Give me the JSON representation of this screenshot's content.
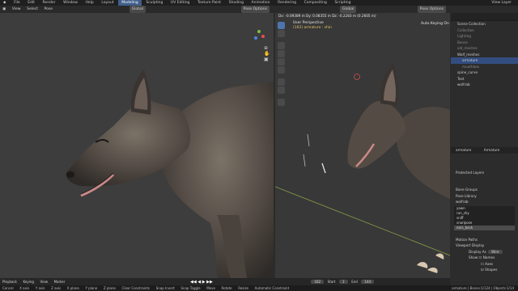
{
  "topbar": {
    "menus": [
      "File",
      "Edit",
      "Render",
      "Window",
      "Help"
    ],
    "workspaces": [
      "Layout",
      "Modeling",
      "Sculpting",
      "UV Editing",
      "Texture Paint",
      "Shading",
      "Animation",
      "Rendering",
      "Compositing",
      "Scripting"
    ],
    "active_workspace": "Modeling",
    "scene_label": "View Layer"
  },
  "left_view": {
    "menus": [
      "View",
      "Select",
      "Pose"
    ],
    "orientation": "Global",
    "pose_options": "Pose Options"
  },
  "right_view": {
    "delta_readout": "Dx: -0.09389 m  Dy: 0.08355 m  Dz: -0.2283 m (0.2605 m)",
    "orientation": "Global",
    "pose_options": "Pose Options",
    "title": "User Perspective",
    "subtitle": "(162) armature : shin",
    "auto_keying": "Auto Keying On"
  },
  "outliner": {
    "items": [
      {
        "label": "Scene Collection",
        "selected": false,
        "dim": false
      },
      {
        "label": "Collection",
        "selected": false,
        "dim": true
      },
      {
        "label": "Lighting",
        "selected": false,
        "dim": true
      },
      {
        "label": "Bones",
        "selected": false,
        "dim": true
      },
      {
        "label": "old_meshes",
        "selected": false,
        "dim": true
      },
      {
        "label": "Wolf_meshes",
        "selected": false,
        "dim": false
      },
      {
        "label": "armature",
        "selected": true,
        "dim": false
      },
      {
        "label": "mouthbox",
        "selected": false,
        "dim": true
      },
      {
        "label": "spine_curve",
        "selected": false,
        "dim": false
      },
      {
        "label": "Text",
        "selected": false,
        "dim": false
      },
      {
        "label": "wolfrab",
        "selected": false,
        "dim": false
      }
    ]
  },
  "properties": {
    "object_name": "armature",
    "data_name": "Armature",
    "section_layers": "Protected Layers",
    "bone_groups": "Bone Groups",
    "pose_library": "Pose Library",
    "library_name": "wolfrab",
    "poses": [
      "yawn",
      "run_shy",
      "sniff",
      "snarlpose",
      "ears_back"
    ],
    "selected_pose": "ears_back",
    "motion_paths": "Motion Paths",
    "viewport_display": "Viewport Display",
    "display_as_label": "Display As",
    "display_as_value": "Wire",
    "show_label": "Show",
    "show_names": "Names",
    "show_axes": "Axes",
    "show_shapes": "Shapes"
  },
  "timeline": {
    "menus": [
      "Playback",
      "Keying",
      "View",
      "Marker"
    ],
    "current_frame": "162",
    "start_label": "Start",
    "start": "1",
    "end_label": "End",
    "end": "144"
  },
  "status": {
    "items": [
      "Cancel",
      "X axis",
      "Y axis",
      "Z axis",
      "X plane",
      "Y plane",
      "Z plane",
      "Clear Constraints",
      "Snap Invert",
      "Snap Toggle",
      "Move",
      "Rotate",
      "Resize",
      "Automatic Constraint",
      "Automatic Constraint Plane"
    ],
    "right_text": "armature | Bones:1/124 | Objects:1/14"
  },
  "colors": {
    "accent": "#4f74ad",
    "selection": "#334d80"
  }
}
